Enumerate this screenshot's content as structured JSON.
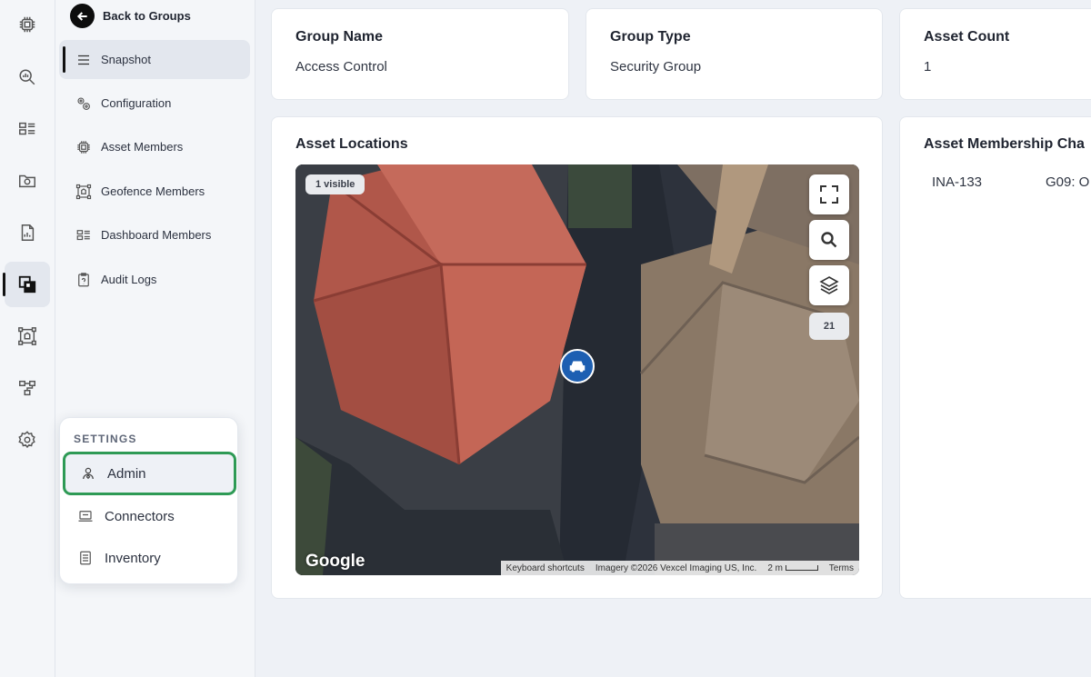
{
  "rail": {
    "items": [
      {
        "icon": "chip-icon"
      },
      {
        "icon": "analytics-search-icon"
      },
      {
        "icon": "dashboard-icon"
      },
      {
        "icon": "camera-folder-icon"
      },
      {
        "icon": "report-icon"
      },
      {
        "icon": "groups-icon",
        "active": true
      },
      {
        "icon": "geofence-icon"
      },
      {
        "icon": "hierarchy-icon"
      },
      {
        "icon": "settings-gear-icon"
      }
    ]
  },
  "subnav": {
    "back_label": "Back to Groups",
    "items": [
      {
        "label": "Snapshot",
        "icon": "list-icon",
        "active": true
      },
      {
        "label": "Configuration",
        "icon": "gears-icon"
      },
      {
        "label": "Asset Members",
        "icon": "chip-icon"
      },
      {
        "label": "Geofence Members",
        "icon": "geofence-icon"
      },
      {
        "label": "Dashboard Members",
        "icon": "dashboard-icon"
      },
      {
        "label": "Audit Logs",
        "icon": "clipboard-icon"
      }
    ]
  },
  "settings_popup": {
    "title": "SETTINGS",
    "items": [
      {
        "label": "Admin",
        "icon": "admin-user-icon",
        "highlighted": true
      },
      {
        "label": "Connectors",
        "icon": "connector-icon"
      },
      {
        "label": "Inventory",
        "icon": "inventory-icon"
      }
    ],
    "highlight_color": "#2e9a55"
  },
  "cards": {
    "group_name": {
      "label": "Group Name",
      "value": "Access Control"
    },
    "group_type": {
      "label": "Group Type",
      "value": "Security Group"
    },
    "asset_count": {
      "label": "Asset Count",
      "value": "1"
    }
  },
  "asset_locations": {
    "title": "Asset Locations",
    "visible_badge": "1 visible",
    "zoom_level": "21",
    "google_logo": "Google",
    "attribution": {
      "shortcuts": "Keyboard shortcuts",
      "imagery": "Imagery ©2026 Vexcel Imaging US, Inc.",
      "scale": "2 m",
      "terms": "Terms"
    },
    "marker_icon": "car-icon"
  },
  "membership_chart": {
    "title": "Asset Membership Cha",
    "asset": "INA-133",
    "group": "G09: O"
  },
  "colors": {
    "accent": "#1d5fb2",
    "background": "#eef1f6"
  }
}
